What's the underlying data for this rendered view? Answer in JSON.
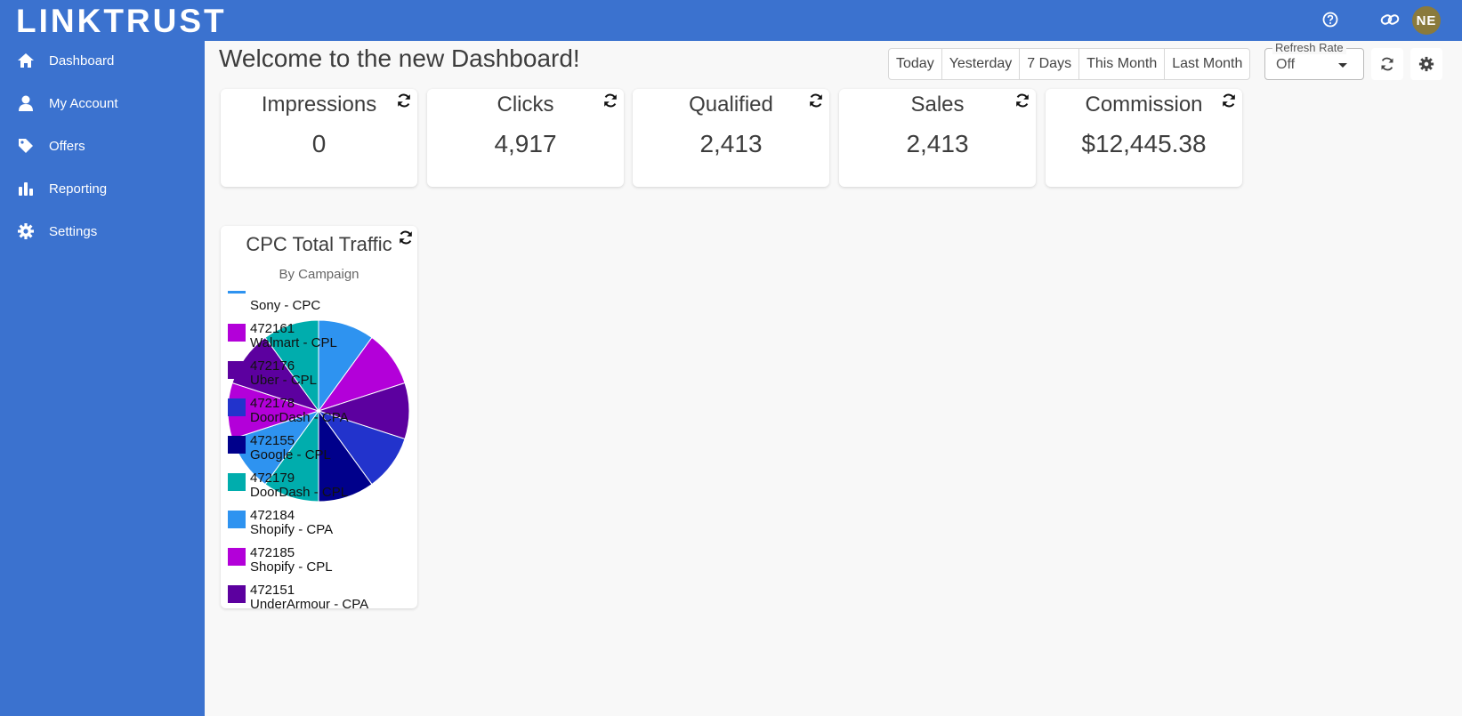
{
  "header": {
    "logo_text": "LINKTRUST",
    "user_initials": "NE"
  },
  "sidebar": {
    "items": [
      {
        "label": "Dashboard",
        "icon": "home-icon"
      },
      {
        "label": "My Account",
        "icon": "person-icon"
      },
      {
        "label": "Offers",
        "icon": "tag-icon"
      },
      {
        "label": "Reporting",
        "icon": "bar-chart-icon"
      },
      {
        "label": "Settings",
        "icon": "gear-icon"
      }
    ]
  },
  "main": {
    "title": "Welcome to the new Dashboard!",
    "date_ranges": [
      "Today",
      "Yesterday",
      "7 Days",
      "This Month",
      "Last Month"
    ],
    "refresh_rate": {
      "label": "Refresh Rate",
      "value": "Off"
    }
  },
  "stats": [
    {
      "label": "Impressions",
      "value": "0"
    },
    {
      "label": "Clicks",
      "value": "4,917"
    },
    {
      "label": "Qualified",
      "value": "2,413"
    },
    {
      "label": "Sales",
      "value": "2,413"
    },
    {
      "label": "Commission",
      "value": "$12,445.38"
    }
  ],
  "colors": {
    "brand": "#3b72cf",
    "background": "#f8f8f8"
  },
  "chart_data": {
    "type": "pie",
    "title": "CPC Total Traffic",
    "subtitle": "By Campaign",
    "legend_position": "overlay-left",
    "slices": [
      {
        "id": "472184",
        "name": "Shopify - CPA",
        "value": 1,
        "color": "#2e93f0"
      },
      {
        "id": "472185",
        "name": "Shopify - CPL",
        "value": 1,
        "color": "#b300d9"
      },
      {
        "id": "472151",
        "name": "UnderArmour - CPA",
        "value": 1,
        "color": "#5c009f"
      },
      {
        "id": "472178",
        "name": "DoorDash - CPA",
        "value": 1,
        "color": "#2233cc"
      },
      {
        "id": "472155",
        "name": "Google - CPL",
        "value": 1,
        "color": "#00008b"
      },
      {
        "id": "472179",
        "name": "DoorDash - CPL",
        "value": 1,
        "color": "#00adad"
      },
      {
        "id": "",
        "name": "Sony - CPC",
        "value": 1,
        "color": "#2e93f0"
      },
      {
        "id": "472161",
        "name": "Walmart - CPL",
        "value": 1,
        "color": "#b300d9"
      },
      {
        "id": "472176",
        "name": "Uber - CPL",
        "value": 1,
        "color": "#5c009f"
      },
      {
        "id": "",
        "name": "",
        "value": 1,
        "color": "#00adad"
      }
    ],
    "legend": [
      {
        "id": "",
        "name": "Sony - CPC",
        "color": "#2e93f0"
      },
      {
        "id": "472161",
        "name": "Walmart - CPL",
        "color": "#b300d9"
      },
      {
        "id": "472176",
        "name": "Uber - CPL",
        "color": "#5c009f"
      },
      {
        "id": "472178",
        "name": "DoorDash - CPA",
        "color": "#2233cc"
      },
      {
        "id": "472155",
        "name": "Google - CPL",
        "color": "#00008b"
      },
      {
        "id": "472179",
        "name": "DoorDash - CPL",
        "color": "#00adad"
      },
      {
        "id": "472184",
        "name": "Shopify - CPA",
        "color": "#2e93f0"
      },
      {
        "id": "472185",
        "name": "Shopify - CPL",
        "color": "#b300d9"
      },
      {
        "id": "472151",
        "name": "UnderArmour - CPA",
        "color": "#5c009f"
      }
    ]
  }
}
